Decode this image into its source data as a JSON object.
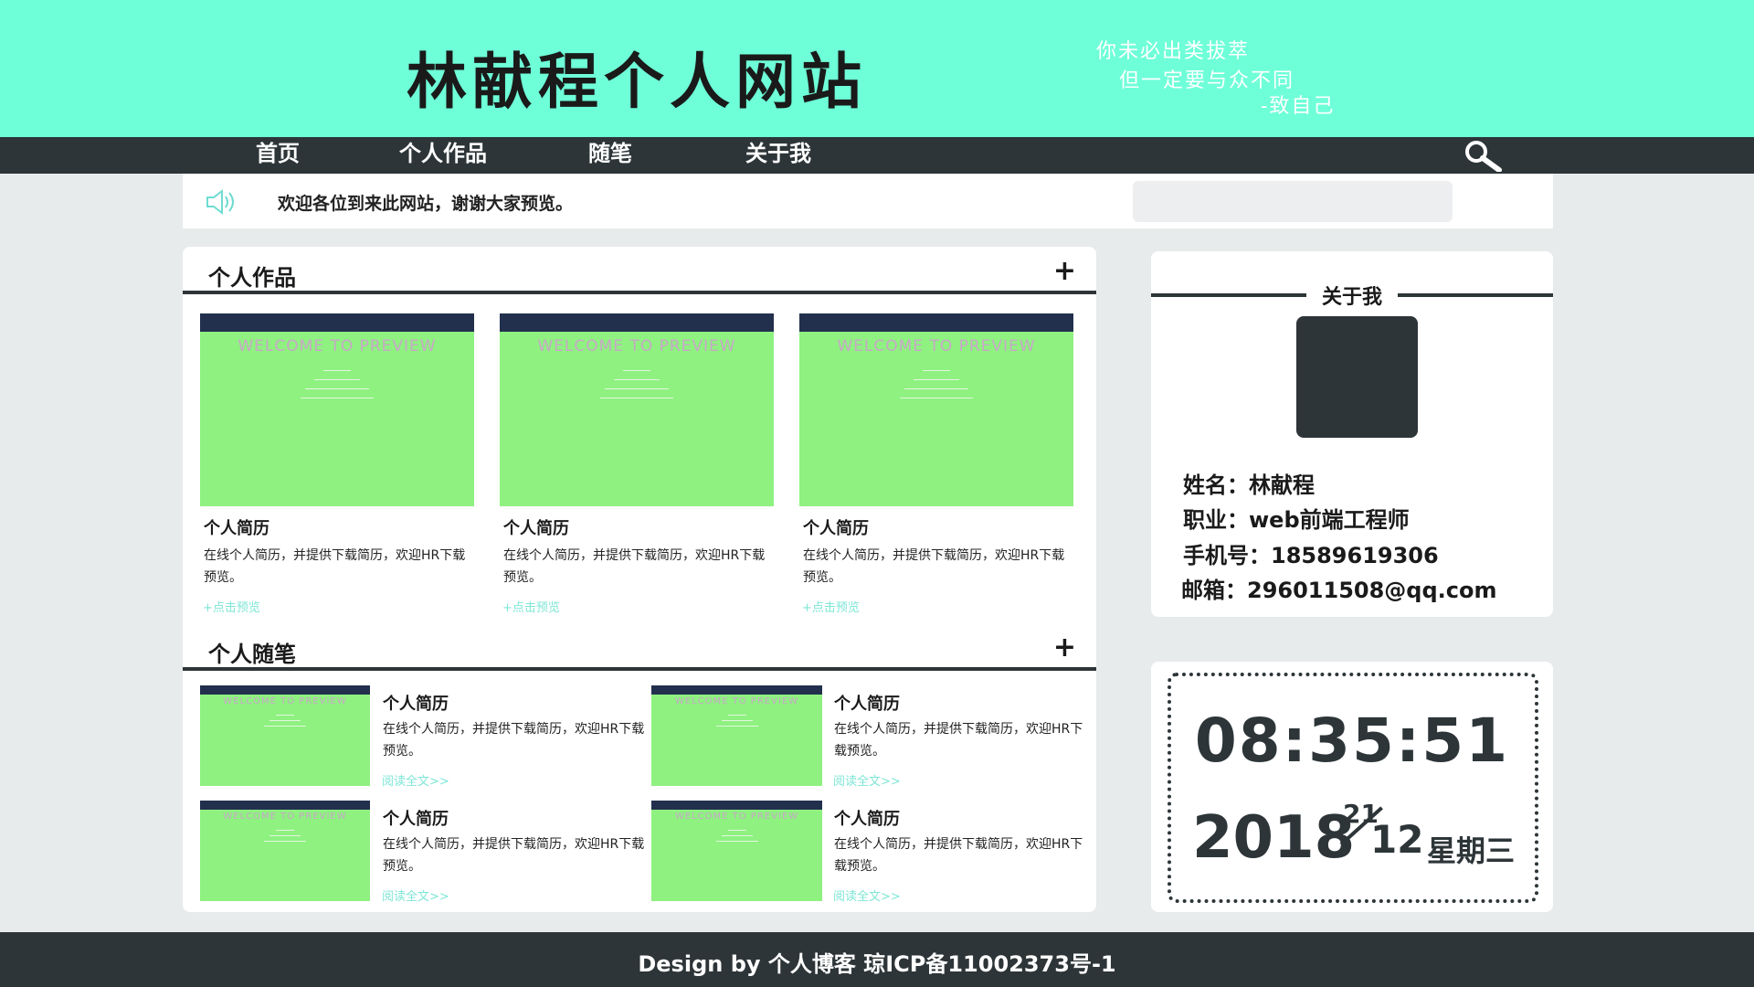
{
  "header": {
    "site_title": "林献程个人网站",
    "motto": [
      "你未必出类拔萃",
      "但一定要与众不同",
      "-致自己"
    ]
  },
  "nav": {
    "items": [
      "首页",
      "个人作品",
      "随笔",
      "关于我"
    ],
    "search_icon": "search-icon"
  },
  "notice": {
    "icon": "speaker-icon",
    "text": "欢迎各位到来此网站，谢谢大家预览。",
    "search_value": ""
  },
  "works": {
    "title": "个人作品",
    "plus": "+",
    "thumb_welcome": "WELCOME TO PREVIEW",
    "cards": [
      {
        "title": "个人简历",
        "desc": "在线个人简历，并提供下载简历，欢迎HR下载预览。",
        "link": "+点击预览"
      },
      {
        "title": "个人简历",
        "desc": "在线个人简历，并提供下载简历，欢迎HR下载预览。",
        "link": "+点击预览"
      },
      {
        "title": "个人简历",
        "desc": "在线个人简历，并提供下载简历，欢迎HR下载预览。",
        "link": "+点击预览"
      }
    ]
  },
  "essays": {
    "title": "个人随笔",
    "plus": "+",
    "thumb_welcome": "WELCOME TO PREVIEW",
    "items": [
      {
        "title": "个人简历",
        "desc": "在线个人简历，并提供下载简历，欢迎HR下载预览。",
        "link": "阅读全文>>"
      },
      {
        "title": "个人简历",
        "desc": "在线个人简历，并提供下载简历，欢迎HR下载预览。",
        "link": "阅读全文>>"
      },
      {
        "title": "个人简历",
        "desc": "在线个人简历，并提供下载简历，欢迎HR下载预览。",
        "link": "阅读全文>>"
      },
      {
        "title": "个人简历",
        "desc": "在线个人简历，并提供下载简历，欢迎HR下载预览。",
        "link": "阅读全文>>"
      }
    ]
  },
  "about": {
    "title": "关于我",
    "info": [
      "姓名：林献程",
      "职业：web前端工程师",
      "手机号：18589619306",
      "邮箱：296011508@qq.com"
    ]
  },
  "clock": {
    "time": "08:35:51",
    "year": "2018",
    "day": "21",
    "month": "12",
    "weekday": "星期三"
  },
  "footer": {
    "text": "Design by 个人博客 琼ICP备11002373号-1"
  },
  "colors": {
    "header_bg": "#6effd8",
    "dark": "#2d3538",
    "thumb_green": "#8ef180",
    "link": "#7de6d6"
  }
}
